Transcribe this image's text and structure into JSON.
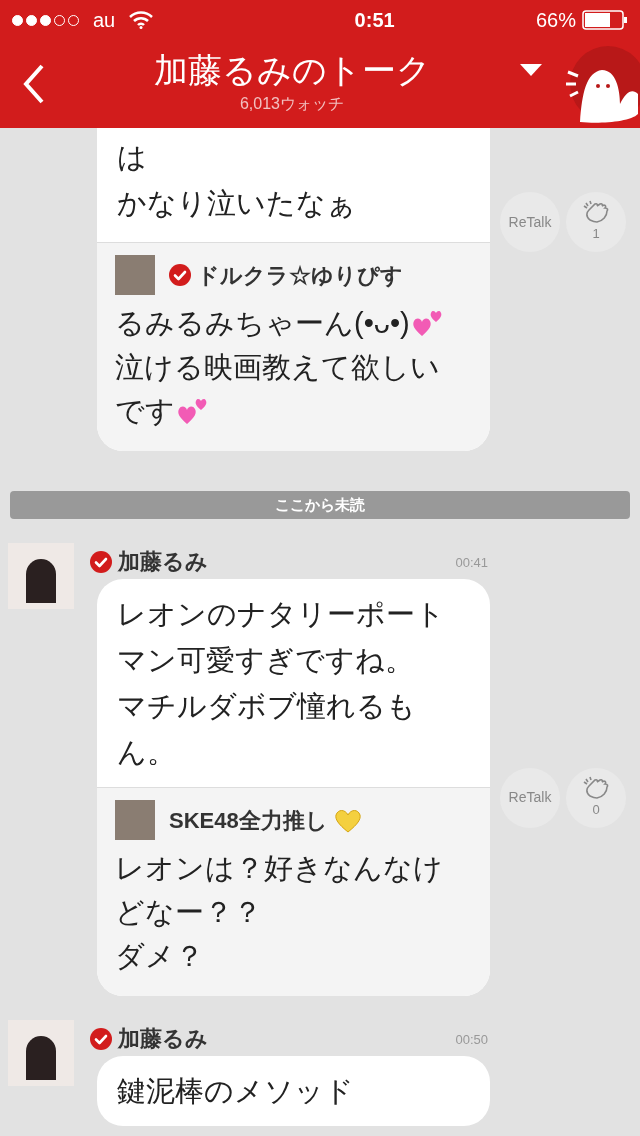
{
  "status_bar": {
    "carrier": "au",
    "time": "0:51",
    "battery": "66%"
  },
  "header": {
    "title": "加藤るみのトーク",
    "subtitle": "6,013ウォッチ"
  },
  "messages": [
    {
      "kind": "continued",
      "lines": [
        "は",
        "かなり泣いたなぁ"
      ],
      "reply": {
        "name": "ドルクラ☆ゆりぴす",
        "verified": true,
        "lines": [
          {
            "kind": "hearts",
            "text": "るみるみちゃーん(•ᴗ•)"
          },
          {
            "kind": "plain",
            "text": "泣ける映画教えて欲しい"
          },
          {
            "kind": "hearts",
            "text": "です"
          }
        ]
      },
      "retalk": "ReTalk",
      "claps": "1"
    },
    {
      "kind": "divider",
      "label": "ここから未読"
    },
    {
      "kind": "message",
      "name": "加藤るみ",
      "verified": true,
      "time": "00:41",
      "lines": [
        "レオンのナタリーポート",
        "マン可愛すぎですね。",
        "マチルダボブ憧れるも",
        "ん。"
      ],
      "reply": {
        "name": "SKE48全力推し",
        "verified": false,
        "kind": "heart",
        "lines": [
          {
            "kind": "plain",
            "text": "レオンは？好きなんなけ"
          },
          {
            "kind": "plain",
            "text": "どなー？？"
          },
          {
            "kind": "plain",
            "text": "ダメ？"
          }
        ]
      },
      "retalk": "ReTalk",
      "claps": "0"
    },
    {
      "kind": "message",
      "name": "加藤るみ",
      "verified": true,
      "time": "00:50",
      "lines": [
        "鍵泥棒のメソッド"
      ]
    }
  ]
}
